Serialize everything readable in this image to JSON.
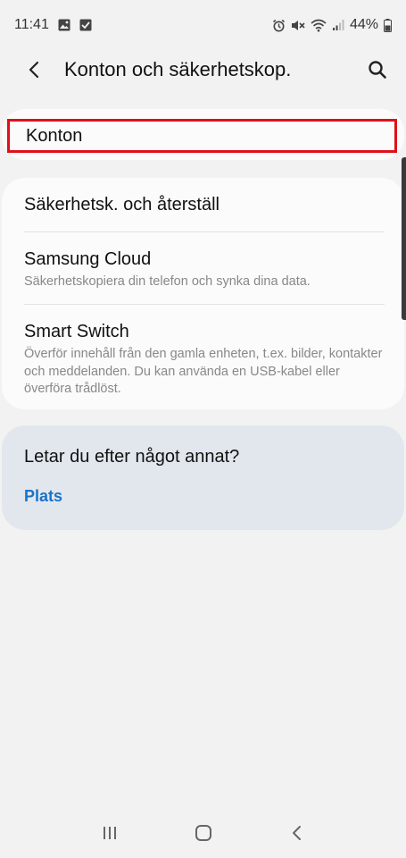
{
  "status_bar": {
    "time": "11:41",
    "battery": "44%",
    "icons_left": [
      "image-icon",
      "check-box-icon"
    ],
    "icons_right": [
      "alarm-icon",
      "mute-icon",
      "wifi-icon",
      "signal-icon",
      "battery-icon"
    ]
  },
  "header": {
    "title": "Konton och säkerhetskop.",
    "back_icon": "back-arrow-icon",
    "search_icon": "search-icon"
  },
  "sections": {
    "konton": {
      "title": "Konton"
    },
    "items": [
      {
        "title": "Säkerhetsk. och återställ",
        "subtitle": ""
      },
      {
        "title": "Samsung Cloud",
        "subtitle": "Säkerhetskopiera din telefon och synka dina data."
      },
      {
        "title": "Smart Switch",
        "subtitle": "Överför innehåll från den gamla enheten, t.ex. bilder, kontakter och meddelanden. Du kan använda en USB-kabel eller överföra trådlöst."
      }
    ],
    "suggest": {
      "title": "Letar du efter något annat?",
      "link": "Plats"
    }
  },
  "nav_bar": {
    "buttons": [
      "recent-apps-icon",
      "home-icon",
      "back-icon"
    ]
  },
  "colors": {
    "background": "#f2f2f2",
    "card": "#fbfbfb",
    "suggest_card": "#e2e7ee",
    "highlight_border": "#e0101a",
    "link": "#1a73c8"
  }
}
